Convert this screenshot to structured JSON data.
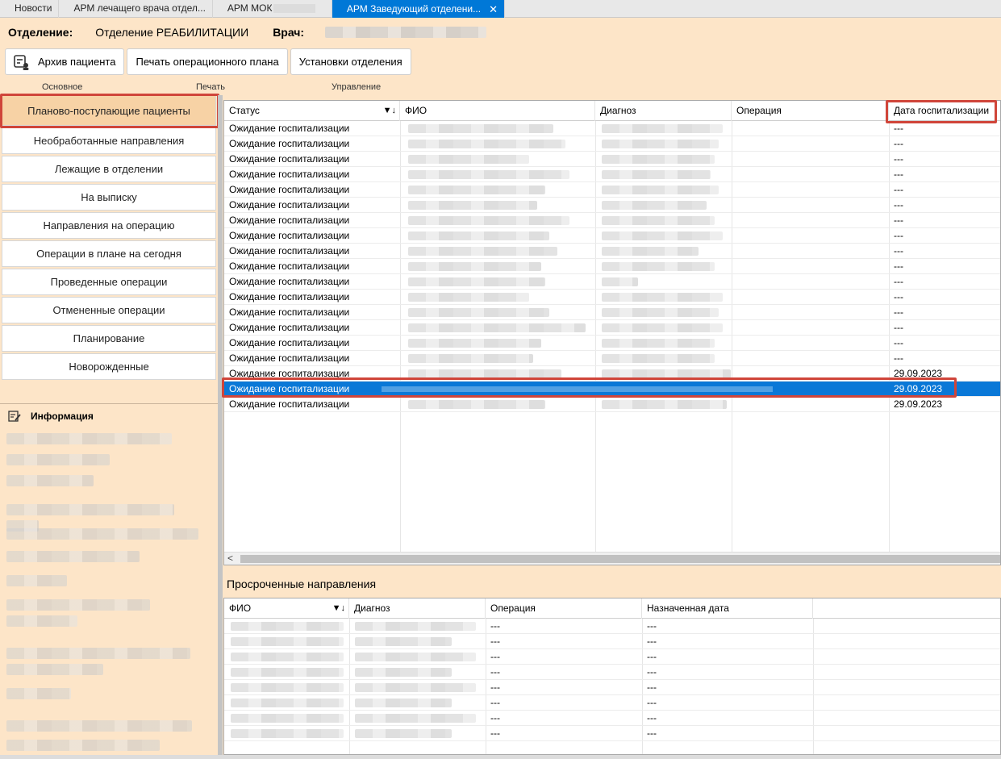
{
  "tabs": [
    {
      "label": "Новости",
      "active": false
    },
    {
      "label": "АРМ лечащего врача отдел...",
      "active": false
    },
    {
      "label": "АРМ МОК",
      "active": false
    },
    {
      "label": "АРМ Заведующий отделени...",
      "active": true
    }
  ],
  "header": {
    "dept_label": "Отделение:",
    "dept_value": "Отделение РЕАБИЛИТАЦИИ",
    "doctor_label": "Врач:"
  },
  "toolbar": {
    "archive": "Архив пациента",
    "print_plan": "Печать операционного плана",
    "settings": "Установки отделения",
    "groups": [
      "Основное",
      "Печать",
      "Управление"
    ]
  },
  "nav": [
    "Планово-поступающие пациенты",
    "Необработанные направления",
    "Лежащие в отделении",
    "На выписку",
    "Направления на операцию",
    "Операции в плане на сегодня",
    "Проведенные операции",
    "Отмененные операции",
    "Планирование",
    "Новорожденные"
  ],
  "info": {
    "title": "Информация"
  },
  "grid": {
    "columns": [
      "Статус",
      "ФИО",
      "Диагноз",
      "Операция",
      "Дата госпитализации"
    ],
    "rows": [
      {
        "status": "Ожидание госпитализации",
        "date": "---"
      },
      {
        "status": "Ожидание госпитализации",
        "date": "---"
      },
      {
        "status": "Ожидание госпитализации",
        "date": "---"
      },
      {
        "status": "Ожидание госпитализации",
        "date": "---"
      },
      {
        "status": "Ожидание госпитализации",
        "date": "---"
      },
      {
        "status": "Ожидание госпитализации",
        "date": "---"
      },
      {
        "status": "Ожидание госпитализации",
        "date": "---"
      },
      {
        "status": "Ожидание госпитализации",
        "date": "---"
      },
      {
        "status": "Ожидание госпитализации",
        "date": "---"
      },
      {
        "status": "Ожидание госпитализации",
        "date": "---"
      },
      {
        "status": "Ожидание госпитализации",
        "date": "---"
      },
      {
        "status": "Ожидание госпитализации",
        "date": "---"
      },
      {
        "status": "Ожидание госпитализации",
        "date": "---"
      },
      {
        "status": "Ожидание госпитализации",
        "date": "---"
      },
      {
        "status": "Ожидание госпитализации",
        "date": "---"
      },
      {
        "status": "Ожидание госпитализации",
        "date": "---"
      },
      {
        "status": "Ожидание госпитализации",
        "date": "29.09.2023"
      },
      {
        "status": "Ожидание госпитализации",
        "date": "29.09.2023",
        "selected": true
      },
      {
        "status": "Ожидание госпитализации",
        "date": "29.09.2023"
      }
    ],
    "scroll_left": "<"
  },
  "overdue": {
    "title": "Просроченные направления",
    "columns": [
      "ФИО",
      "Диагноз",
      "Операция",
      "Назначенная дата"
    ],
    "rows": [
      {
        "operation": "---",
        "date": "---"
      },
      {
        "operation": "---",
        "date": "---"
      },
      {
        "operation": "---",
        "date": "---"
      },
      {
        "operation": "---",
        "date": "---"
      },
      {
        "operation": "---",
        "date": "---"
      },
      {
        "operation": "---",
        "date": "---"
      },
      {
        "operation": "---",
        "date": "---"
      },
      {
        "operation": "---",
        "date": "---"
      }
    ]
  },
  "colors": {
    "accent": "#0078d7",
    "highlight": "#d0453a",
    "panel": "#fde5c8"
  }
}
